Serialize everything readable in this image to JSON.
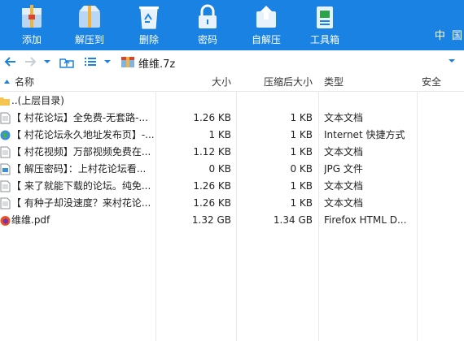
{
  "toolbar": {
    "add": "添加",
    "extract_to": "解压到",
    "delete": "删除",
    "password": "密码",
    "self_extract": "自解压",
    "toolbox": "工具箱",
    "lang": "中 国"
  },
  "address": {
    "archive_name": "维维.7z"
  },
  "columns": {
    "name": "名称",
    "size": "大小",
    "packed": "压缩后大小",
    "type": "类型",
    "security": "安全"
  },
  "rows": [
    {
      "name": "..(上层目录)",
      "size": "",
      "packed": "",
      "type": "",
      "icon": "folder-icon"
    },
    {
      "name": "【 村花论坛】全免费-无套路-...",
      "size": "1.26 KB",
      "packed": "1 KB",
      "type": "文本文档",
      "icon": "text-file-icon"
    },
    {
      "name": "【 村花论坛永久地址发布页】-...",
      "size": "1 KB",
      "packed": "1 KB",
      "type": "Internet 快捷方式",
      "icon": "internet-shortcut-icon"
    },
    {
      "name": "【 村花视频】万部视频免费在...",
      "size": "1.12 KB",
      "packed": "1 KB",
      "type": "文本文档",
      "icon": "text-file-icon"
    },
    {
      "name": "【 解压密码】：上村花论坛看...",
      "size": "0 KB",
      "packed": "0 KB",
      "type": "JPG 文件",
      "icon": "image-file-icon"
    },
    {
      "name": "【 来了就能下载的论坛。纯免...",
      "size": "1.26 KB",
      "packed": "1 KB",
      "type": "文本文档",
      "icon": "text-file-icon"
    },
    {
      "name": "【 有种子却没速度？来村花论...",
      "size": "1.26 KB",
      "packed": "1 KB",
      "type": "文本文档",
      "icon": "text-file-icon"
    },
    {
      "name": "维维.pdf",
      "size": "1.32 GB",
      "packed": "1.34 GB",
      "type": "Firefox HTML D...",
      "icon": "firefox-pdf-icon"
    }
  ],
  "colors": {
    "accent": "#1a82e2"
  }
}
